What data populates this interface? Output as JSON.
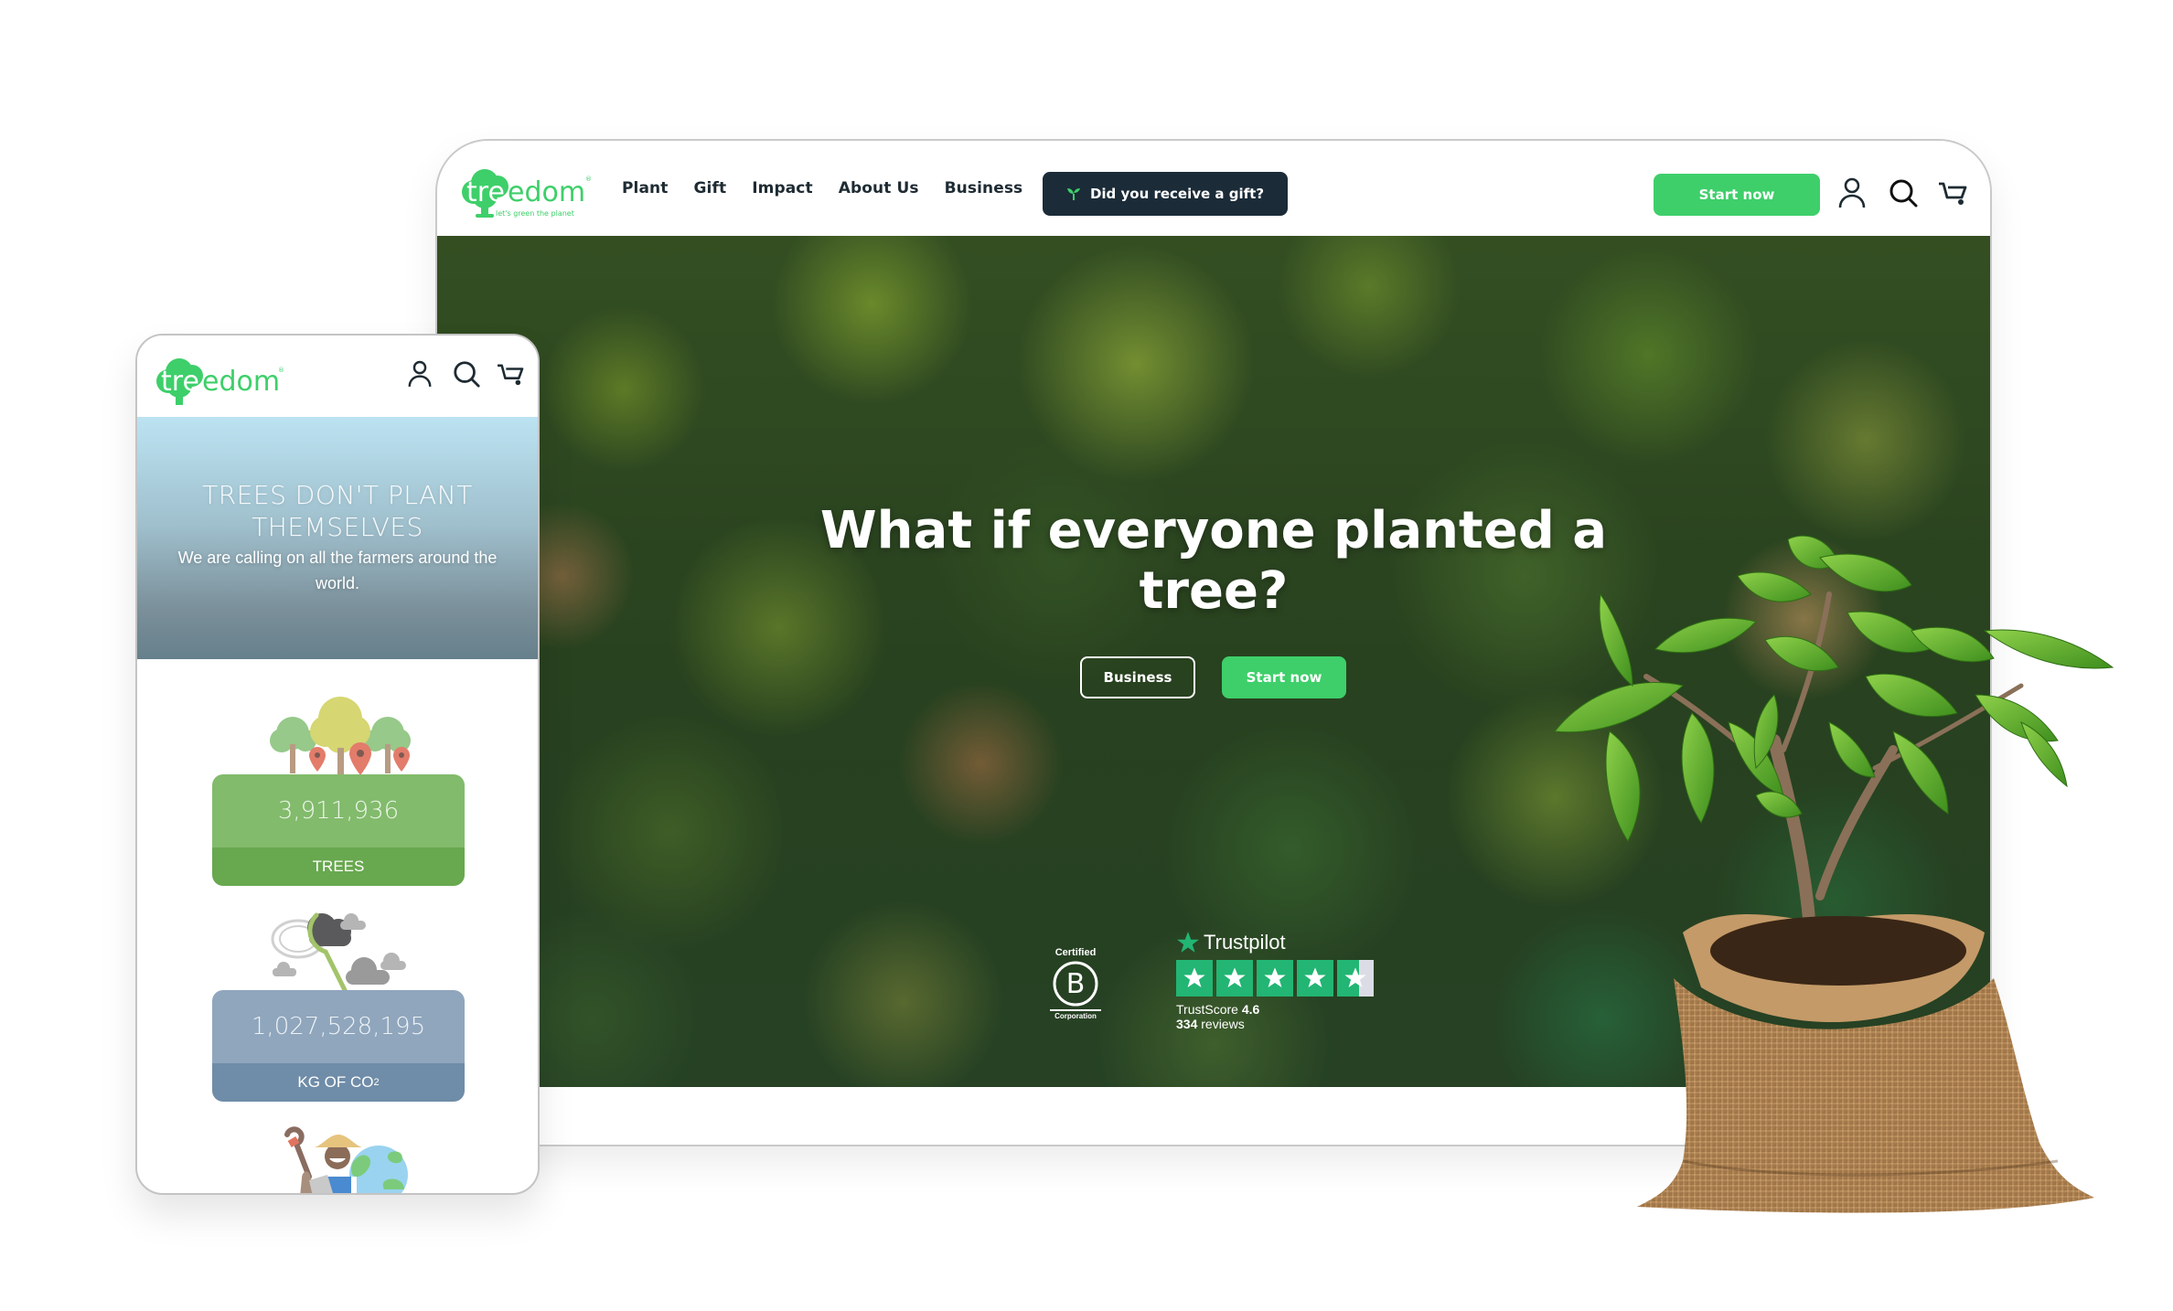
{
  "brand": {
    "name": "treedom",
    "tagline": "let's green the planet",
    "registered_mark": "®",
    "primary_color": "#3ecf6a",
    "dark_color": "#1b2b38"
  },
  "desktop": {
    "nav": [
      {
        "label": "Plant"
      },
      {
        "label": "Gift"
      },
      {
        "label": "Impact"
      },
      {
        "label": "About Us"
      },
      {
        "label": "Business"
      }
    ],
    "gift_button": {
      "label": "Did you receive a gift?",
      "icon": "sprout-icon"
    },
    "start_button": {
      "label": "Start now"
    },
    "header_icons": [
      "user-icon",
      "search-icon",
      "cart-icon"
    ],
    "hero": {
      "title": "What if everyone planted a tree?",
      "buttons": [
        {
          "label": "Business"
        },
        {
          "label": "Start now"
        }
      ]
    },
    "bcorp": {
      "top": "Certified",
      "letter": "B",
      "bottom": "Corporation"
    },
    "trustpilot": {
      "brand": "Trustpilot",
      "stars": 4.6,
      "star_count": 5,
      "score_label": "TrustScore",
      "score": "4.6",
      "reviews_count": "334",
      "reviews_label": "reviews",
      "star_color": "#22b573"
    }
  },
  "mobile": {
    "header_icons": [
      "user-icon",
      "search-icon",
      "cart-icon"
    ],
    "hero": {
      "title": "TREES DON'T PLANT THEMSELVES",
      "subtitle": "We are calling on all the farmers around the world."
    },
    "stats": [
      {
        "value": "3,911,936",
        "label": "TREES",
        "illustration": "trees-with-pins"
      },
      {
        "value": "1,027,528,195",
        "label": "KG OF CO",
        "label_subscript": "2",
        "illustration": "clouds-with-net"
      }
    ],
    "partial_illustration": "farmer-with-globe"
  },
  "decor": {
    "product_image": "sapling-in-burlap-sack"
  }
}
